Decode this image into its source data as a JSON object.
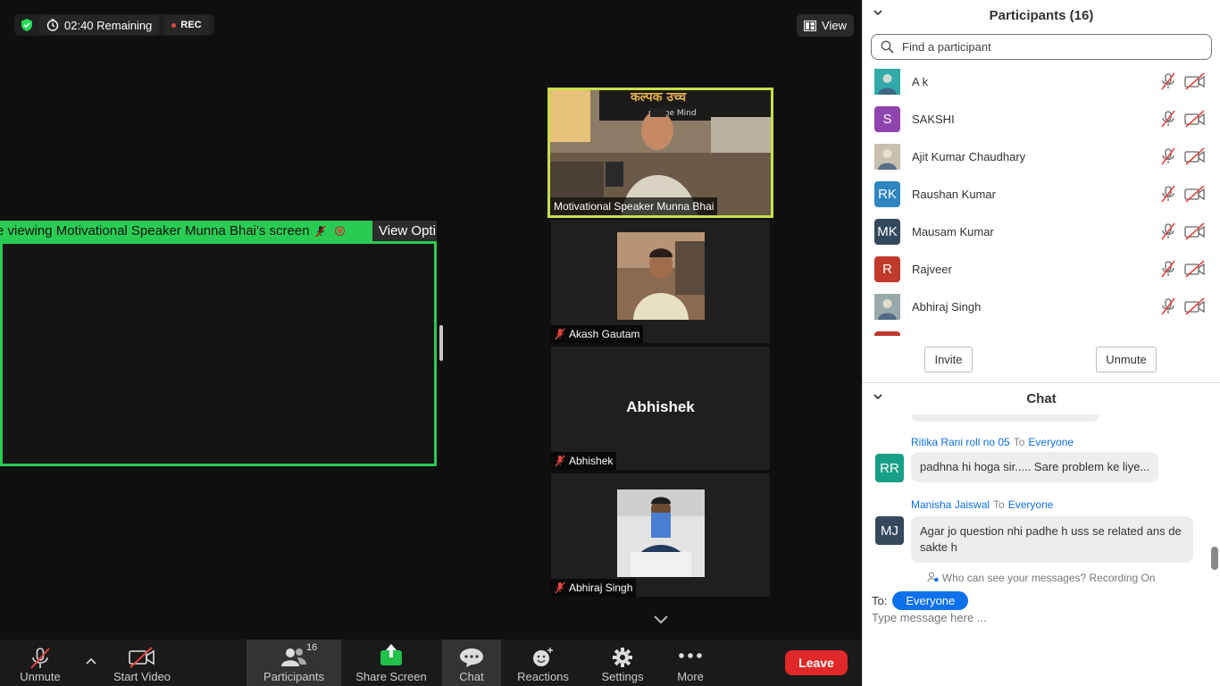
{
  "meeting": {
    "timer_text": "02:40 Remaining",
    "rec_label": "REC",
    "view_label": "View",
    "share_banner": "e viewing Motivational Speaker Munna Bhai's screen",
    "view_options": "View Opti"
  },
  "tiles": [
    {
      "name": "Motivational Speaker Munna Bhai"
    },
    {
      "name": "Akash Gautam"
    },
    {
      "name": "Abhishek",
      "big_name": "Abhishek"
    },
    {
      "name": "Abhiraj Singh"
    }
  ],
  "toolbar": {
    "unmute": "Unmute",
    "start_video": "Start Video",
    "participants": "Participants",
    "participants_count": "16",
    "share_screen": "Share Screen",
    "chat": "Chat",
    "reactions": "Reactions",
    "settings": "Settings",
    "more": "More",
    "leave": "Leave"
  },
  "participants_panel": {
    "title": "Participants (16)",
    "search_placeholder": "Find a participant",
    "invite": "Invite",
    "unmute": "Unmute",
    "list": [
      {
        "name": "A k",
        "initials": "",
        "color": "#3aa"
      },
      {
        "name": "SAKSHI",
        "initials": "S",
        "color": "#8e44ad"
      },
      {
        "name": "Ajit Kumar Chaudhary",
        "initials": "",
        "color": "#c9c0b0"
      },
      {
        "name": "Raushan Kumar",
        "initials": "RK",
        "color": "#2e86c1"
      },
      {
        "name": "Mausam Kumar",
        "initials": "MK",
        "color": "#34495e"
      },
      {
        "name": "Rajveer",
        "initials": "R",
        "color": "#c0392b"
      },
      {
        "name": "Abhiraj Singh",
        "initials": "",
        "color": "#9aa"
      }
    ]
  },
  "chat_panel": {
    "title": "Chat",
    "messages": [
      {
        "sender": "Ritika Rani roll no 05",
        "to_word": "To",
        "recipient": "Everyone",
        "initials": "RR",
        "color": "#17a085",
        "text": "padhna hi hoga sir..... Sare problem ke liye..."
      },
      {
        "sender": "Manisha Jaiswal",
        "to_word": "To",
        "recipient": "Everyone",
        "initials": "MJ",
        "color": "#34495e",
        "text": "Agar jo question nhi padhe h uss se related ans de sakte h"
      }
    ],
    "privacy_note": "Who can see your messages? Recording On",
    "to_label": "To:",
    "to_value": "Everyone",
    "input_placeholder": "Type message here ..."
  }
}
